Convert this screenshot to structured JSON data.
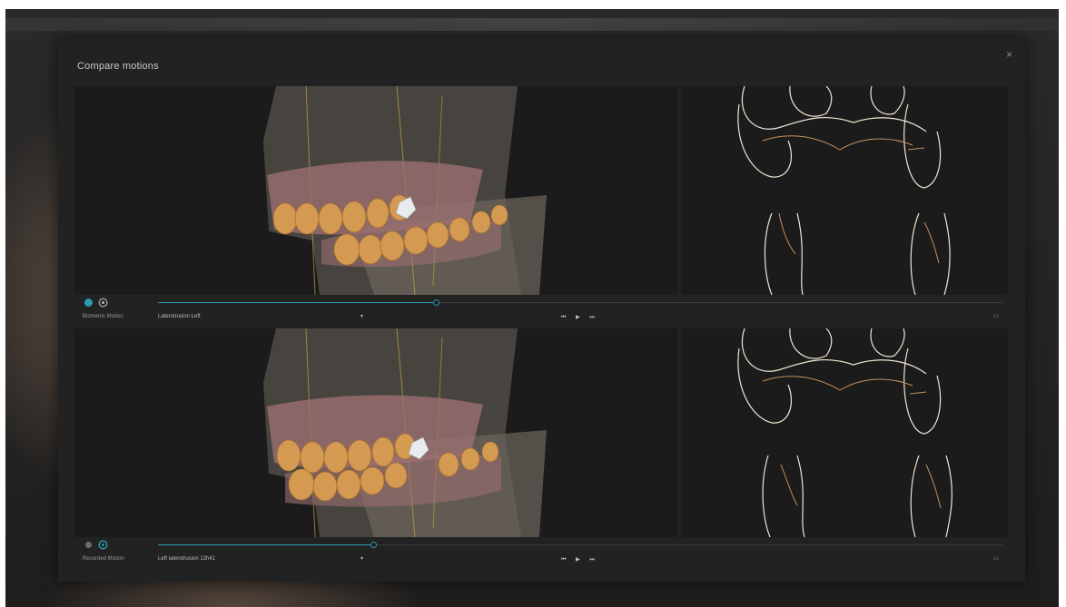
{
  "dialog": {
    "title": "Compare motions",
    "close_label": "×"
  },
  "panels": [
    {
      "motion_label": "Biometric Motion",
      "selected_motion": "Laterotrusion Left",
      "progress": 0.33,
      "playback": {
        "skip_back": "⏮",
        "play": "▶",
        "skip_forward": "⏭"
      },
      "speed": "1x",
      "radio": [
        "active",
        "ring"
      ]
    },
    {
      "motion_label": "Recorded Motion",
      "selected_motion": "Left laterotrusion 12h41",
      "progress": 0.26,
      "playback": {
        "skip_back": "⏮",
        "play": "▶",
        "skip_forward": "⏭"
      },
      "speed": "1x",
      "radio": [
        "inactive",
        "ring-teal"
      ]
    }
  ],
  "icons": {
    "select_caret": "caret-down-icon",
    "skip_back": "skip-back-icon",
    "play": "play-icon",
    "skip_forward": "skip-forward-icon"
  },
  "colors": {
    "accent": "#2a9bb3",
    "modal_bg": "#222222",
    "viewport_bg": "#1b1b1b",
    "tooth": "#d49a52",
    "gum": "#9b6f70",
    "outline_cream": "#f0e6d2",
    "outline_orange": "#c89060"
  }
}
